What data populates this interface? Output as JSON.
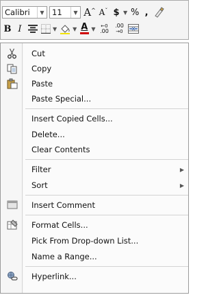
{
  "mini_toolbar": {
    "font_name": "Calibri",
    "font_size": "11",
    "grow_label": "A",
    "shrink_label": "A",
    "currency_label": "$",
    "percent_label": "%",
    "comma_label": ",",
    "bold_label": "B",
    "italic_label": "I",
    "font_color_label": "A",
    "increase_decimal_label": ".00",
    "decrease_decimal_label": ".00"
  },
  "menu": {
    "items": [
      {
        "label": "Cut",
        "icon": "scissors-icon"
      },
      {
        "label": "Copy",
        "icon": "copy-icon"
      },
      {
        "label": "Paste",
        "icon": "paste-icon"
      },
      {
        "label": "Paste Special..."
      },
      {
        "label": "Insert Copied Cells..."
      },
      {
        "label": "Delete..."
      },
      {
        "label": "Clear Contents"
      },
      {
        "label": "Filter",
        "submenu": true
      },
      {
        "label": "Sort",
        "submenu": true
      },
      {
        "label": "Insert Comment",
        "icon": "comment-icon"
      },
      {
        "label": "Format Cells...",
        "icon": "format-cells-icon"
      },
      {
        "label": "Pick From Drop-down List..."
      },
      {
        "label": "Name a Range..."
      },
      {
        "label": "Hyperlink...",
        "icon": "hyperlink-icon"
      }
    ]
  },
  "colors": {
    "highlight_yellow": "#f2e300",
    "font_red": "#d00000"
  }
}
